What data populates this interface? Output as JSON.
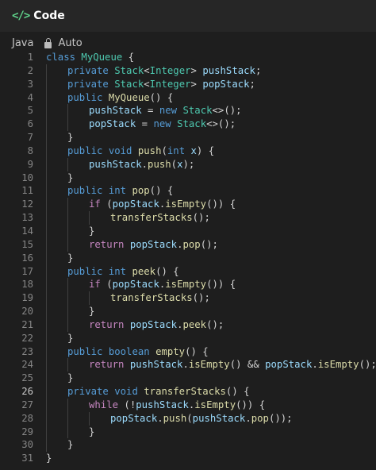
{
  "header": {
    "title": "Code",
    "icon": "code-icon"
  },
  "toolbar": {
    "language": "Java",
    "mode": "Auto"
  },
  "editor": {
    "active_line": 26,
    "lines": [
      {
        "n": "1",
        "indent": 0,
        "tokens": [
          [
            "k",
            "class "
          ],
          [
            "t",
            "MyQueue"
          ],
          [
            "p",
            " {"
          ]
        ]
      },
      {
        "n": "2",
        "indent": 1,
        "tokens": [
          [
            "k",
            "private "
          ],
          [
            "t",
            "Stack"
          ],
          [
            "p",
            "<"
          ],
          [
            "t",
            "Integer"
          ],
          [
            "p",
            "> "
          ],
          [
            "v",
            "pushStack"
          ],
          [
            "p",
            ";"
          ]
        ]
      },
      {
        "n": "3",
        "indent": 1,
        "tokens": [
          [
            "k",
            "private "
          ],
          [
            "t",
            "Stack"
          ],
          [
            "p",
            "<"
          ],
          [
            "t",
            "Integer"
          ],
          [
            "p",
            "> "
          ],
          [
            "v",
            "popStack"
          ],
          [
            "p",
            ";"
          ]
        ]
      },
      {
        "n": "4",
        "indent": 1,
        "tokens": [
          [
            "k",
            "public "
          ],
          [
            "f",
            "MyQueue"
          ],
          [
            "p",
            "() {"
          ]
        ]
      },
      {
        "n": "5",
        "indent": 2,
        "tokens": [
          [
            "v",
            "pushStack"
          ],
          [
            "p",
            " = "
          ],
          [
            "k",
            "new "
          ],
          [
            "t",
            "Stack"
          ],
          [
            "p",
            "<>();"
          ]
        ]
      },
      {
        "n": "6",
        "indent": 2,
        "tokens": [
          [
            "v",
            "popStack"
          ],
          [
            "p",
            " = "
          ],
          [
            "k",
            "new "
          ],
          [
            "t",
            "Stack"
          ],
          [
            "p",
            "<>();"
          ]
        ]
      },
      {
        "n": "7",
        "indent": 1,
        "tokens": [
          [
            "p",
            "}"
          ]
        ]
      },
      {
        "n": "8",
        "indent": 1,
        "tokens": [
          [
            "k",
            "public "
          ],
          [
            "k",
            "void "
          ],
          [
            "f",
            "push"
          ],
          [
            "p",
            "("
          ],
          [
            "k",
            "int "
          ],
          [
            "v",
            "x"
          ],
          [
            "p",
            ") {"
          ]
        ]
      },
      {
        "n": "9",
        "indent": 2,
        "tokens": [
          [
            "v",
            "pushStack"
          ],
          [
            "p",
            "."
          ],
          [
            "f",
            "push"
          ],
          [
            "p",
            "("
          ],
          [
            "v",
            "x"
          ],
          [
            "p",
            ");"
          ]
        ]
      },
      {
        "n": "10",
        "indent": 1,
        "tokens": [
          [
            "p",
            "}"
          ]
        ]
      },
      {
        "n": "11",
        "indent": 1,
        "tokens": [
          [
            "k",
            "public "
          ],
          [
            "k",
            "int "
          ],
          [
            "f",
            "pop"
          ],
          [
            "p",
            "() {"
          ]
        ]
      },
      {
        "n": "12",
        "indent": 2,
        "tokens": [
          [
            "kc",
            "if "
          ],
          [
            "p",
            "("
          ],
          [
            "v",
            "popStack"
          ],
          [
            "p",
            "."
          ],
          [
            "f",
            "isEmpty"
          ],
          [
            "p",
            "()) {"
          ]
        ]
      },
      {
        "n": "13",
        "indent": 3,
        "tokens": [
          [
            "f",
            "transferStacks"
          ],
          [
            "p",
            "();"
          ]
        ]
      },
      {
        "n": "14",
        "indent": 2,
        "tokens": [
          [
            "p",
            "}"
          ]
        ]
      },
      {
        "n": "15",
        "indent": 2,
        "tokens": [
          [
            "kc",
            "return "
          ],
          [
            "v",
            "popStack"
          ],
          [
            "p",
            "."
          ],
          [
            "f",
            "pop"
          ],
          [
            "p",
            "();"
          ]
        ]
      },
      {
        "n": "16",
        "indent": 1,
        "tokens": [
          [
            "p",
            "}"
          ]
        ]
      },
      {
        "n": "17",
        "indent": 1,
        "tokens": [
          [
            "k",
            "public "
          ],
          [
            "k",
            "int "
          ],
          [
            "f",
            "peek"
          ],
          [
            "p",
            "() {"
          ]
        ]
      },
      {
        "n": "18",
        "indent": 2,
        "tokens": [
          [
            "kc",
            "if "
          ],
          [
            "p",
            "("
          ],
          [
            "v",
            "popStack"
          ],
          [
            "p",
            "."
          ],
          [
            "f",
            "isEmpty"
          ],
          [
            "p",
            "()) {"
          ]
        ]
      },
      {
        "n": "19",
        "indent": 3,
        "tokens": [
          [
            "f",
            "transferStacks"
          ],
          [
            "p",
            "();"
          ]
        ]
      },
      {
        "n": "20",
        "indent": 2,
        "tokens": [
          [
            "p",
            "}"
          ]
        ]
      },
      {
        "n": "21",
        "indent": 2,
        "tokens": [
          [
            "kc",
            "return "
          ],
          [
            "v",
            "popStack"
          ],
          [
            "p",
            "."
          ],
          [
            "f",
            "peek"
          ],
          [
            "p",
            "();"
          ]
        ]
      },
      {
        "n": "22",
        "indent": 1,
        "tokens": [
          [
            "p",
            "}"
          ]
        ]
      },
      {
        "n": "23",
        "indent": 1,
        "tokens": [
          [
            "k",
            "public "
          ],
          [
            "k",
            "boolean "
          ],
          [
            "f",
            "empty"
          ],
          [
            "p",
            "() {"
          ]
        ]
      },
      {
        "n": "24",
        "indent": 2,
        "tokens": [
          [
            "kc",
            "return "
          ],
          [
            "v",
            "pushStack"
          ],
          [
            "p",
            "."
          ],
          [
            "f",
            "isEmpty"
          ],
          [
            "p",
            "() && "
          ],
          [
            "v",
            "popStack"
          ],
          [
            "p",
            "."
          ],
          [
            "f",
            "isEmpty"
          ],
          [
            "p",
            "();"
          ]
        ]
      },
      {
        "n": "25",
        "indent": 1,
        "tokens": [
          [
            "p",
            "}"
          ]
        ]
      },
      {
        "n": "26",
        "indent": 1,
        "tokens": [
          [
            "k",
            "private "
          ],
          [
            "k",
            "void "
          ],
          [
            "f",
            "transferStacks"
          ],
          [
            "p",
            "() {"
          ]
        ]
      },
      {
        "n": "27",
        "indent": 2,
        "tokens": [
          [
            "kc",
            "while "
          ],
          [
            "p",
            "(!"
          ],
          [
            "v",
            "pushStack"
          ],
          [
            "p",
            "."
          ],
          [
            "f",
            "isEmpty"
          ],
          [
            "p",
            "()) {"
          ]
        ]
      },
      {
        "n": "28",
        "indent": 3,
        "tokens": [
          [
            "v",
            "popStack"
          ],
          [
            "p",
            "."
          ],
          [
            "f",
            "push"
          ],
          [
            "p",
            "("
          ],
          [
            "v",
            "pushStack"
          ],
          [
            "p",
            "."
          ],
          [
            "f",
            "pop"
          ],
          [
            "p",
            "());"
          ]
        ]
      },
      {
        "n": "29",
        "indent": 2,
        "tokens": [
          [
            "p",
            "}"
          ]
        ]
      },
      {
        "n": "30",
        "indent": 1,
        "tokens": [
          [
            "p",
            "}"
          ]
        ]
      },
      {
        "n": "31",
        "indent": 0,
        "tokens": [
          [
            "p",
            "}"
          ]
        ]
      }
    ]
  }
}
